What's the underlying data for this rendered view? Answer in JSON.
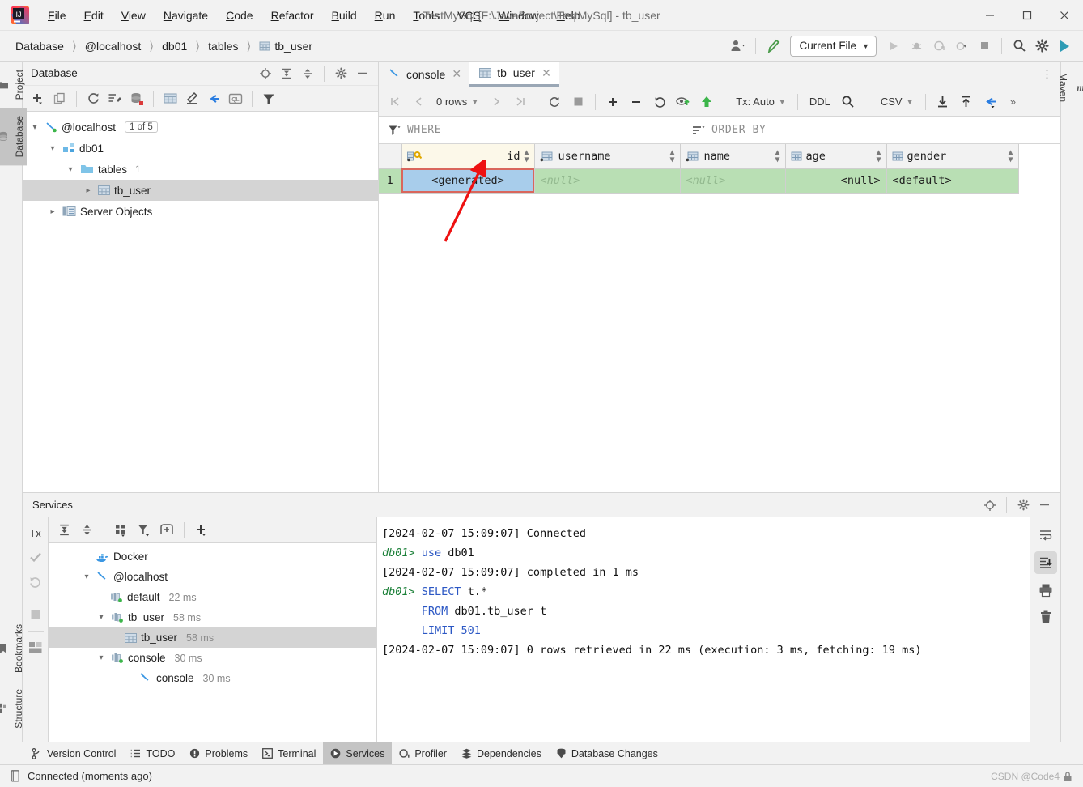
{
  "titlebar": {
    "window_title": "TestMySql [F:\\JavaPorject\\TestMySql] - tb_user",
    "menus": [
      "File",
      "Edit",
      "View",
      "Navigate",
      "Code",
      "Refactor",
      "Build",
      "Run",
      "Tools",
      "VCS",
      "Window",
      "Help"
    ],
    "minimize": "—",
    "maximize": "☐",
    "close": "✕"
  },
  "navbar": {
    "crumbs": [
      "Database",
      "@localhost",
      "db01",
      "tables",
      "tb_user"
    ],
    "separator": "〉",
    "run_config": "Current File",
    "chevron": "▾"
  },
  "left_strip": {
    "project": "Project",
    "database": "Database",
    "bookmarks": "Bookmarks",
    "structure": "Structure"
  },
  "right_strip": {
    "maven": "Maven"
  },
  "database_panel": {
    "title": "Database",
    "tree": [
      {
        "label": "@localhost",
        "badge": "1 of 5",
        "depth": 0,
        "expanded": true,
        "icon": "connection-icon"
      },
      {
        "label": "db01",
        "depth": 1,
        "expanded": true,
        "icon": "schema-icon"
      },
      {
        "label": "tables",
        "count": "1",
        "depth": 2,
        "expanded": true,
        "icon": "folder-icon"
      },
      {
        "label": "tb_user",
        "depth": 3,
        "expanded": false,
        "icon": "table-icon",
        "selected": true
      },
      {
        "label": "Server Objects",
        "depth": 1,
        "expanded": false,
        "icon": "server-objects-icon"
      }
    ]
  },
  "editor": {
    "tabs": [
      {
        "label": "console",
        "icon": "console-icon",
        "active": false
      },
      {
        "label": "tb_user",
        "icon": "table-icon",
        "active": true
      }
    ],
    "close_glyph": "✕",
    "more_glyph": "⋮"
  },
  "grid_toolbar": {
    "first": "|⟨",
    "prev": "‹",
    "rows_label": "0 rows",
    "next": "›",
    "last": "⟩|",
    "tx_label": "Tx: Auto",
    "ddl_label": "DDL",
    "csv_label": "CSV",
    "overflow": "»"
  },
  "filter_bar": {
    "where": "WHERE",
    "order_by": "ORDER BY"
  },
  "grid": {
    "columns": [
      {
        "name": "id",
        "icon": "primary-key-icon"
      },
      {
        "name": "username",
        "icon": "column-icon"
      },
      {
        "name": "name",
        "icon": "column-icon"
      },
      {
        "name": "age",
        "icon": "column-icon"
      },
      {
        "name": "gender",
        "icon": "column-icon"
      }
    ],
    "rows": [
      {
        "number": "1",
        "cells": [
          "<generated>",
          "<null>",
          "<null>",
          "<null>",
          "<default>"
        ]
      }
    ],
    "sort_glyph": "↕"
  },
  "services": {
    "title": "Services",
    "tree": [
      {
        "label": "Docker",
        "depth": 1,
        "icon": "docker-icon",
        "expanded": null
      },
      {
        "label": "@localhost",
        "depth": 1,
        "icon": "connection-icon",
        "expanded": true
      },
      {
        "label": "default",
        "time": "22 ms",
        "depth": 2,
        "icon": "session-icon"
      },
      {
        "label": "tb_user",
        "time": "58 ms",
        "depth": 2,
        "icon": "session-icon",
        "expanded": true
      },
      {
        "label": "tb_user",
        "time": "58 ms",
        "depth": 3,
        "icon": "table-icon",
        "selected": true
      },
      {
        "label": "console",
        "time": "30 ms",
        "depth": 2,
        "icon": "session-icon",
        "expanded": true
      },
      {
        "label": "console",
        "time": "30 ms",
        "depth": 3,
        "icon": "console-icon"
      }
    ],
    "tx_label": "Tx"
  },
  "console_output": [
    {
      "parts": [
        {
          "t": "[2024-02-07 15:09:07] Connected",
          "c": "plain"
        }
      ]
    },
    {
      "parts": [
        {
          "t": "db01> ",
          "c": "prompt"
        },
        {
          "t": "use",
          "c": "kw"
        },
        {
          "t": " db01",
          "c": "plain"
        }
      ]
    },
    {
      "parts": [
        {
          "t": "[2024-02-07 15:09:07] completed in 1 ms",
          "c": "plain"
        }
      ]
    },
    {
      "parts": [
        {
          "t": "db01> ",
          "c": "prompt"
        },
        {
          "t": "SELECT",
          "c": "kw"
        },
        {
          "t": " t.*",
          "c": "plain"
        }
      ]
    },
    {
      "parts": [
        {
          "t": "      FROM",
          "c": "kw"
        },
        {
          "t": " db01.tb_user t",
          "c": "plain"
        }
      ]
    },
    {
      "parts": [
        {
          "t": "      LIMIT",
          "c": "kw"
        },
        {
          "t": " ",
          "c": "plain"
        },
        {
          "t": "501",
          "c": "kw"
        }
      ]
    },
    {
      "parts": [
        {
          "t": "[2024-02-07 15:09:07] 0 rows retrieved in 22 ms (execution: 3 ms, fetching: 19 ms)",
          "c": "plain"
        }
      ]
    }
  ],
  "tool_window_buttons": [
    {
      "label": "Version Control",
      "icon": "branch-icon",
      "active": false
    },
    {
      "label": "TODO",
      "icon": "list-icon",
      "active": false
    },
    {
      "label": "Problems",
      "icon": "error-icon",
      "active": false
    },
    {
      "label": "Terminal",
      "icon": "terminal-icon",
      "active": false
    },
    {
      "label": "Services",
      "icon": "services-icon",
      "active": true
    },
    {
      "label": "Profiler",
      "icon": "profiler-icon",
      "active": false
    },
    {
      "label": "Dependencies",
      "icon": "dependencies-icon",
      "active": false
    },
    {
      "label": "Database Changes",
      "icon": "db-changes-icon",
      "active": false
    }
  ],
  "statusbar": {
    "text": "Connected (moments ago)",
    "watermark": "CSDN @Code4"
  },
  "colors": {
    "new_row_green": "#b9dfb4",
    "selected_cell_blue": "#a8cdeb",
    "selection_outline_red": "#d9665c",
    "annotation_red": "#ee1111",
    "id_header_yellow": "#fcf8e9",
    "accent_blue": "#3b97e3"
  }
}
